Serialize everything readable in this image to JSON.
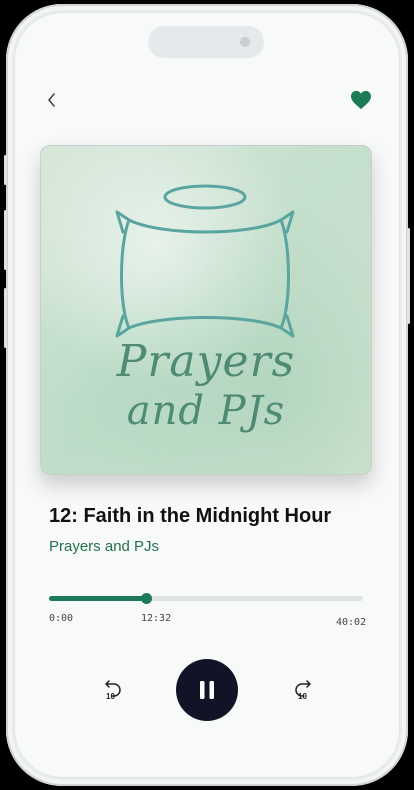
{
  "header": {
    "back_icon": "chevron-left-icon",
    "favorite_icon": "heart-icon",
    "favorite_active": true,
    "accent_color": "#1c7a57"
  },
  "cover": {
    "line1": "Prayers",
    "line2": "and PJs",
    "icons": [
      "halo-icon",
      "pillow-icon"
    ]
  },
  "episode": {
    "title": "12: Faith in the Midnight Hour",
    "podcast": "Prayers and PJs"
  },
  "progress": {
    "elapsed_fraction": 0.3092,
    "start_label": "0:00",
    "current_label": "12:32",
    "total_label": "40:02"
  },
  "controls": {
    "rewind_icon": "rewind-10-icon",
    "rewind_seconds": "10",
    "play_pause_icon": "pause-icon",
    "forward_icon": "forward-10-icon",
    "forward_seconds": "10"
  }
}
